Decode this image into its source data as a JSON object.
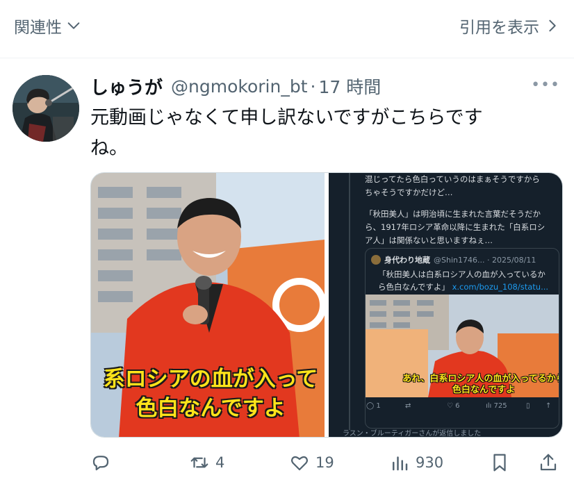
{
  "topbar": {
    "relevance_label": "関連性",
    "quotes_label": "引用を表示"
  },
  "tweet": {
    "display_name": "しゅうが",
    "handle": "@ngmokorin_bt",
    "separator": "·",
    "time": "17 時間",
    "text_line1": "元動画じゃなくて申し訳ないですがこちらです",
    "text_line2": "ね。",
    "media": {
      "left_caption_line1": "系ロシアの血が入って",
      "left_caption_line2": "色白なんですよ",
      "right": {
        "text_lines": [
          "混じってたら色白っていうのはまぁそうですから",
          "ちゃそうですかだけど…",
          "",
          "「秋田美人」は明治頃に生まれた言葉だそうだか",
          "ら、1917年ロシア革命以降に生まれた「白系ロシ",
          "ア人」は関係ないと思いますねぇ…"
        ],
        "quote_name": "身代わり地蔵",
        "quote_handle": "@Shin1746... · 2025/08/11",
        "quote_line1": "「秋田美人は白系ロシア人の血が入っているか",
        "quote_line2": "ら色白なんですよ」",
        "quote_link": "x.com/bozu_108/statu...",
        "inner_caption_line1": "あれ、白系ロシア人の血が入ってるから",
        "inner_caption_line2": "色白なんですよ",
        "inner_actions": {
          "replies": "1",
          "likes": "6",
          "views": "725"
        },
        "reply_notice": "ラスン・ブルーティガーさんが返信しました"
      }
    },
    "actions": {
      "replies": "",
      "retweets": "4",
      "likes": "19",
      "views": "930"
    }
  },
  "colors": {
    "secondary_text": "#536471",
    "border": "#eff3f4",
    "caption_yellow": "#ffe41a",
    "jacket_red": "#e2381f",
    "link_blue": "#1d9bf0",
    "dark_bg": "#15202b"
  },
  "icons": [
    "chevron-down-icon",
    "chevron-right-icon",
    "more-icon",
    "reply-icon",
    "retweet-icon",
    "like-icon",
    "views-icon",
    "bookmark-icon",
    "share-icon"
  ]
}
